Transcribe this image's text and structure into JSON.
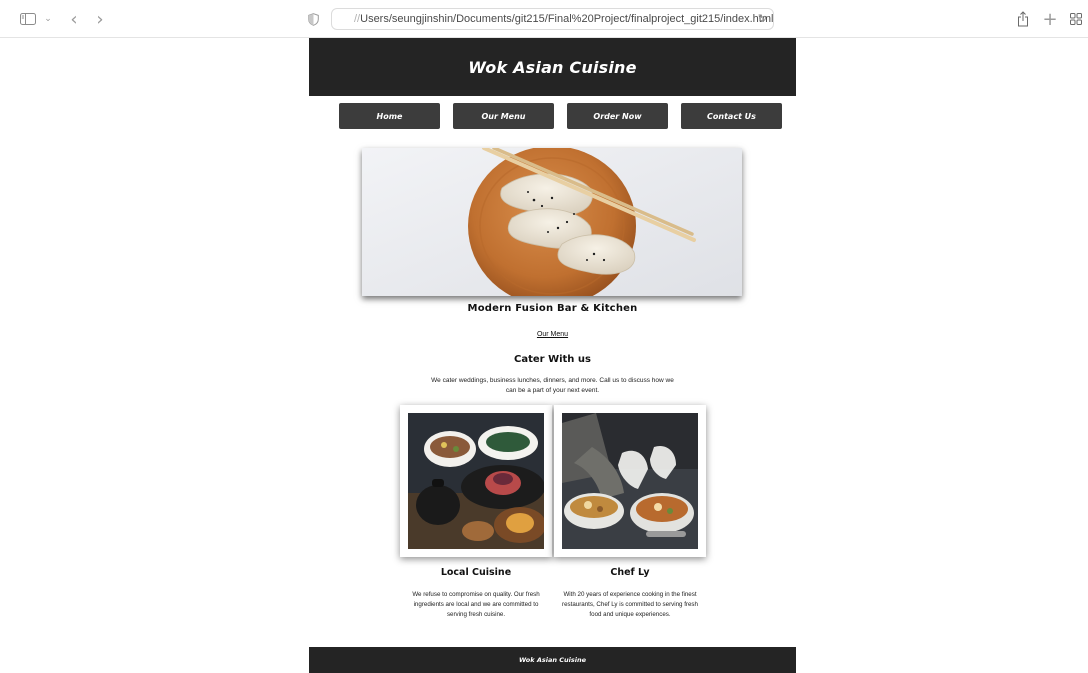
{
  "browser": {
    "address_lead": "//",
    "address": "Users/seungjinshin/Documents/git215/Final%20Project/finalproject_git215/index.html",
    "icons": [
      "sidebar-icon",
      "chevron-down-icon",
      "back-icon",
      "forward-icon",
      "shield-icon",
      "reload-icon",
      "share-icon",
      "new-tab-icon",
      "tab-overview-icon"
    ],
    "glyphs": {
      "back": "‹",
      "forward": "›",
      "reload": "↻",
      "plus": "+",
      "chevron": "⌄"
    }
  },
  "site": {
    "brand": "Wok Asian Cuisine",
    "nav": [
      "Home",
      "Our Menu",
      "Order Now",
      "Contact Us"
    ],
    "tagline": "Modern Fusion Bar & Kitchen",
    "menu_link": "Our Menu",
    "cater_title": "Cater With us",
    "cater_text": "We cater weddings, business lunches, dinners, and more. Call us to discuss how we can be a part of your next event.",
    "columns": [
      {
        "title": "Local Cuisine",
        "text": "We refuse to compromise on quality. Our fresh ingredients are local and we are committed to serving fresh cuisine."
      },
      {
        "title": "Chef Ly",
        "text": "With 20 years of experience cooking in the finest restaurants, Chef Ly is committed to serving fresh food and unique experiences."
      }
    ],
    "footer": "Wok Asian Cuisine"
  },
  "colors": {
    "header_bg": "#242424",
    "nav_button_bg": "#3c3c3c",
    "page_bg": "#ffffff"
  }
}
